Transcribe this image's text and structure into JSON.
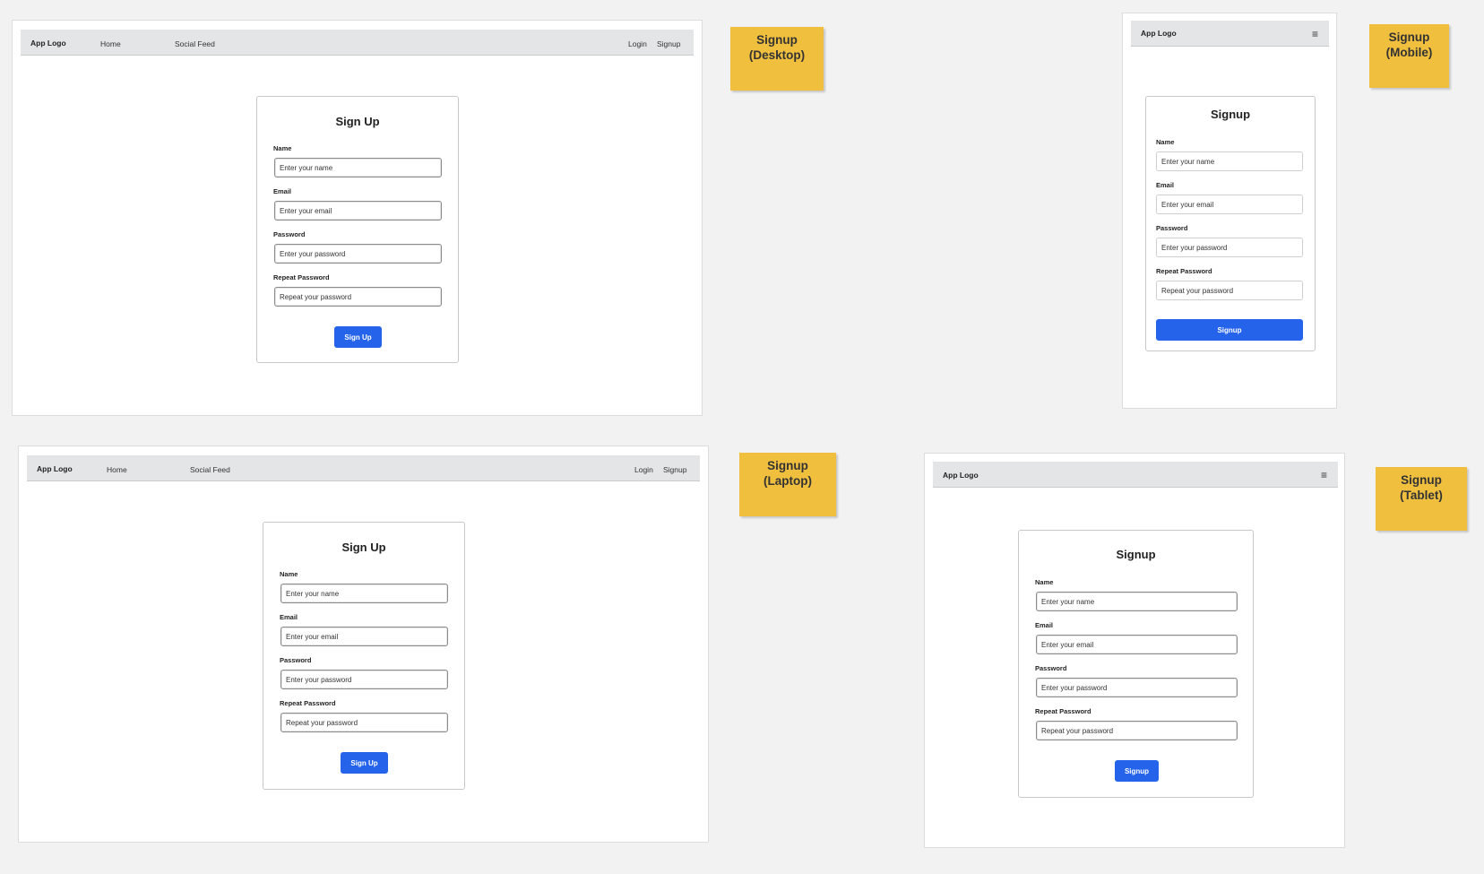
{
  "nav": {
    "logo": "App Logo",
    "home": "Home",
    "social_feed": "Social Feed",
    "login": "Login",
    "signup": "Signup",
    "menu_icon": "hamburger-menu-icon"
  },
  "form": {
    "title_desktop": "Sign Up",
    "title_mobile": "Signup",
    "name_label": "Name",
    "name_placeholder": "Enter your name",
    "email_label": "Email",
    "email_placeholder": "Enter your email",
    "password_label": "Password",
    "password_placeholder": "Enter your password",
    "repeat_label": "Repeat Password",
    "repeat_placeholder": "Repeat your password",
    "button_desktop": "Sign Up",
    "button_mobile": "Signup"
  },
  "notes": {
    "desktop": "Signup\n(Desktop)",
    "mobile": "Signup\n(Mobile)",
    "laptop": "Signup\n(Laptop)",
    "tablet": "Signup\n(Tablet)"
  },
  "colors": {
    "canvas": "#f2f2f2",
    "navbar": "#e4e5e7",
    "primary_button": "#2563eb",
    "sticky_note": "#f0bf3e"
  }
}
